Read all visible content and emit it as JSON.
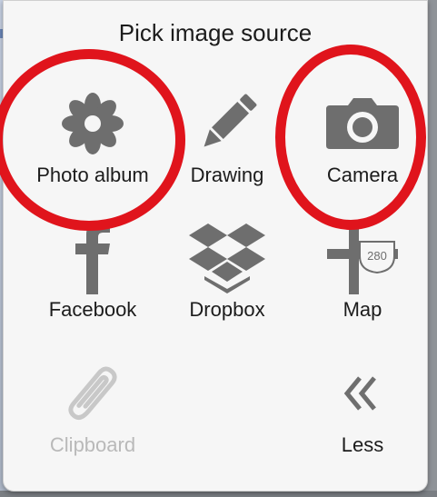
{
  "dialog": {
    "title": "Pick image source"
  },
  "sources": {
    "photo_album": {
      "label": "Photo album",
      "icon": "flower-icon"
    },
    "drawing": {
      "label": "Drawing",
      "icon": "pencil-icon"
    },
    "camera": {
      "label": "Camera",
      "icon": "camera-icon"
    },
    "facebook": {
      "label": "Facebook",
      "icon": "facebook-icon"
    },
    "dropbox": {
      "label": "Dropbox",
      "icon": "dropbox-icon"
    },
    "map": {
      "label": "Map",
      "icon": "map-road-sign-icon",
      "sign_text": "280"
    },
    "clipboard": {
      "label": "Clipboard",
      "icon": "paperclip-icon",
      "disabled": true
    },
    "less": {
      "label": "Less",
      "icon": "double-chevron-left-icon",
      "glyph": "«"
    }
  },
  "colors": {
    "icon_gray": "#6e6e6e",
    "disabled_gray": "#c8c8c8",
    "highlight_red": "#e0141c",
    "panel_bg": "#f6f6f6"
  }
}
